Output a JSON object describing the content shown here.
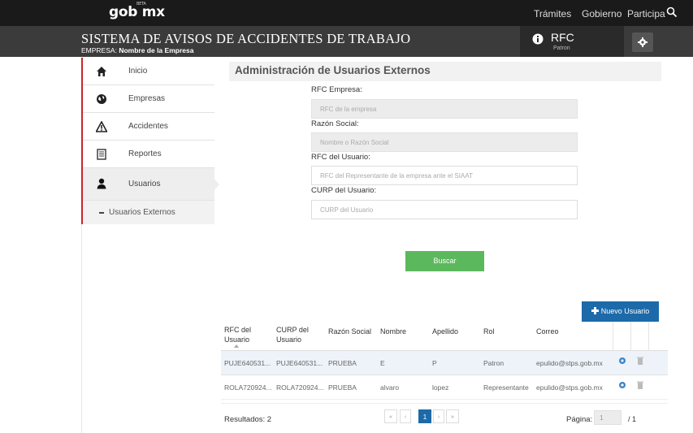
{
  "topbar": {
    "logo": "gob mx",
    "logo_beta": "BETA",
    "nav": [
      "Trámites",
      "Gobierno",
      "Participa"
    ]
  },
  "header": {
    "title": "SISTEMA DE AVISOS DE ACCIDENTES DE TRABAJO",
    "empresa_label": "EMPRESA:",
    "empresa_value": "Nombre de la Empresa",
    "rfc_title": "RFC",
    "rfc_sub": "Patron"
  },
  "sidebar": {
    "items": [
      {
        "label": "Inicio",
        "icon": "home-icon"
      },
      {
        "label": "Empresas",
        "icon": "globe-icon"
      },
      {
        "label": "Accidentes",
        "icon": "warning-icon"
      },
      {
        "label": "Reportes",
        "icon": "report-icon"
      },
      {
        "label": "Usuarios",
        "icon": "user-icon"
      }
    ],
    "sub_item": "Usuarios Externos"
  },
  "main": {
    "title": "Administración de Usuarios Externos",
    "form": {
      "rfc_empresa_label": "RFC Empresa:",
      "rfc_empresa_placeholder": "RFC de la empresa",
      "razon_label": "Razón Social:",
      "razon_placeholder": "Nombre o Razón Social",
      "rfc_usuario_label": "RFC del Usuario:",
      "rfc_usuario_placeholder": "RFC del Representante de la empresa ante el SIAAT",
      "curp_label": "CURP del Usuario:",
      "curp_placeholder": "CURP del Usuario"
    },
    "buscar": "Buscar",
    "nuevo_usuario": "Nuevo Usuario",
    "table": {
      "headers": [
        "RFC del Usuario",
        "CURP del Usuario",
        "Razón Social",
        "Nombre",
        "Apellido",
        "Rol",
        "Correo"
      ],
      "rows": [
        [
          "PUJE640531...",
          "PUJE640531...",
          "PRUEBA",
          "E",
          "P",
          "Patron",
          "epulido@stps.gob.mx"
        ],
        [
          "ROLA720924...",
          "ROLA720924...",
          "PRUEBA",
          "alvaro",
          "lopez",
          "Representante",
          "epulido@stps.gob.mx"
        ]
      ]
    },
    "footer": {
      "resultados": "Resultados: 2",
      "pager": [
        "«",
        "‹",
        "1",
        "›",
        "»"
      ],
      "pagina_label": "Página:",
      "pagina_value": "1",
      "total_pages": "/ 1"
    }
  },
  "colors": {
    "accent_red": "#c9262c",
    "green": "#5cb85c",
    "blue": "#1c6aa9"
  }
}
